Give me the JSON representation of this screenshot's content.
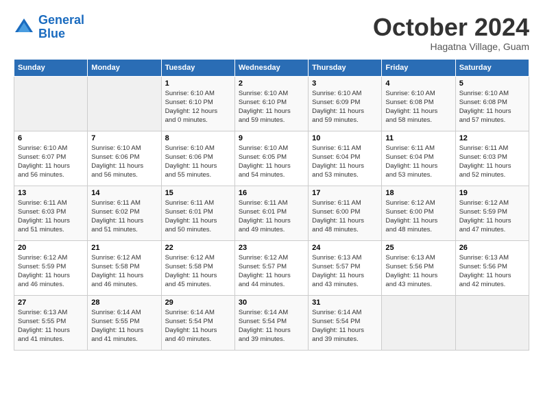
{
  "header": {
    "logo_line1": "General",
    "logo_line2": "Blue",
    "month": "October 2024",
    "location": "Hagatna Village, Guam"
  },
  "weekdays": [
    "Sunday",
    "Monday",
    "Tuesday",
    "Wednesday",
    "Thursday",
    "Friday",
    "Saturday"
  ],
  "weeks": [
    [
      {
        "day": "",
        "info": ""
      },
      {
        "day": "",
        "info": ""
      },
      {
        "day": "1",
        "info": "Sunrise: 6:10 AM\nSunset: 6:10 PM\nDaylight: 12 hours\nand 0 minutes."
      },
      {
        "day": "2",
        "info": "Sunrise: 6:10 AM\nSunset: 6:10 PM\nDaylight: 11 hours\nand 59 minutes."
      },
      {
        "day": "3",
        "info": "Sunrise: 6:10 AM\nSunset: 6:09 PM\nDaylight: 11 hours\nand 59 minutes."
      },
      {
        "day": "4",
        "info": "Sunrise: 6:10 AM\nSunset: 6:08 PM\nDaylight: 11 hours\nand 58 minutes."
      },
      {
        "day": "5",
        "info": "Sunrise: 6:10 AM\nSunset: 6:08 PM\nDaylight: 11 hours\nand 57 minutes."
      }
    ],
    [
      {
        "day": "6",
        "info": "Sunrise: 6:10 AM\nSunset: 6:07 PM\nDaylight: 11 hours\nand 56 minutes."
      },
      {
        "day": "7",
        "info": "Sunrise: 6:10 AM\nSunset: 6:06 PM\nDaylight: 11 hours\nand 56 minutes."
      },
      {
        "day": "8",
        "info": "Sunrise: 6:10 AM\nSunset: 6:06 PM\nDaylight: 11 hours\nand 55 minutes."
      },
      {
        "day": "9",
        "info": "Sunrise: 6:10 AM\nSunset: 6:05 PM\nDaylight: 11 hours\nand 54 minutes."
      },
      {
        "day": "10",
        "info": "Sunrise: 6:11 AM\nSunset: 6:04 PM\nDaylight: 11 hours\nand 53 minutes."
      },
      {
        "day": "11",
        "info": "Sunrise: 6:11 AM\nSunset: 6:04 PM\nDaylight: 11 hours\nand 53 minutes."
      },
      {
        "day": "12",
        "info": "Sunrise: 6:11 AM\nSunset: 6:03 PM\nDaylight: 11 hours\nand 52 minutes."
      }
    ],
    [
      {
        "day": "13",
        "info": "Sunrise: 6:11 AM\nSunset: 6:03 PM\nDaylight: 11 hours\nand 51 minutes."
      },
      {
        "day": "14",
        "info": "Sunrise: 6:11 AM\nSunset: 6:02 PM\nDaylight: 11 hours\nand 51 minutes."
      },
      {
        "day": "15",
        "info": "Sunrise: 6:11 AM\nSunset: 6:01 PM\nDaylight: 11 hours\nand 50 minutes."
      },
      {
        "day": "16",
        "info": "Sunrise: 6:11 AM\nSunset: 6:01 PM\nDaylight: 11 hours\nand 49 minutes."
      },
      {
        "day": "17",
        "info": "Sunrise: 6:11 AM\nSunset: 6:00 PM\nDaylight: 11 hours\nand 48 minutes."
      },
      {
        "day": "18",
        "info": "Sunrise: 6:12 AM\nSunset: 6:00 PM\nDaylight: 11 hours\nand 48 minutes."
      },
      {
        "day": "19",
        "info": "Sunrise: 6:12 AM\nSunset: 5:59 PM\nDaylight: 11 hours\nand 47 minutes."
      }
    ],
    [
      {
        "day": "20",
        "info": "Sunrise: 6:12 AM\nSunset: 5:59 PM\nDaylight: 11 hours\nand 46 minutes."
      },
      {
        "day": "21",
        "info": "Sunrise: 6:12 AM\nSunset: 5:58 PM\nDaylight: 11 hours\nand 46 minutes."
      },
      {
        "day": "22",
        "info": "Sunrise: 6:12 AM\nSunset: 5:58 PM\nDaylight: 11 hours\nand 45 minutes."
      },
      {
        "day": "23",
        "info": "Sunrise: 6:12 AM\nSunset: 5:57 PM\nDaylight: 11 hours\nand 44 minutes."
      },
      {
        "day": "24",
        "info": "Sunrise: 6:13 AM\nSunset: 5:57 PM\nDaylight: 11 hours\nand 43 minutes."
      },
      {
        "day": "25",
        "info": "Sunrise: 6:13 AM\nSunset: 5:56 PM\nDaylight: 11 hours\nand 43 minutes."
      },
      {
        "day": "26",
        "info": "Sunrise: 6:13 AM\nSunset: 5:56 PM\nDaylight: 11 hours\nand 42 minutes."
      }
    ],
    [
      {
        "day": "27",
        "info": "Sunrise: 6:13 AM\nSunset: 5:55 PM\nDaylight: 11 hours\nand 41 minutes."
      },
      {
        "day": "28",
        "info": "Sunrise: 6:14 AM\nSunset: 5:55 PM\nDaylight: 11 hours\nand 41 minutes."
      },
      {
        "day": "29",
        "info": "Sunrise: 6:14 AM\nSunset: 5:54 PM\nDaylight: 11 hours\nand 40 minutes."
      },
      {
        "day": "30",
        "info": "Sunrise: 6:14 AM\nSunset: 5:54 PM\nDaylight: 11 hours\nand 39 minutes."
      },
      {
        "day": "31",
        "info": "Sunrise: 6:14 AM\nSunset: 5:54 PM\nDaylight: 11 hours\nand 39 minutes."
      },
      {
        "day": "",
        "info": ""
      },
      {
        "day": "",
        "info": ""
      }
    ]
  ]
}
